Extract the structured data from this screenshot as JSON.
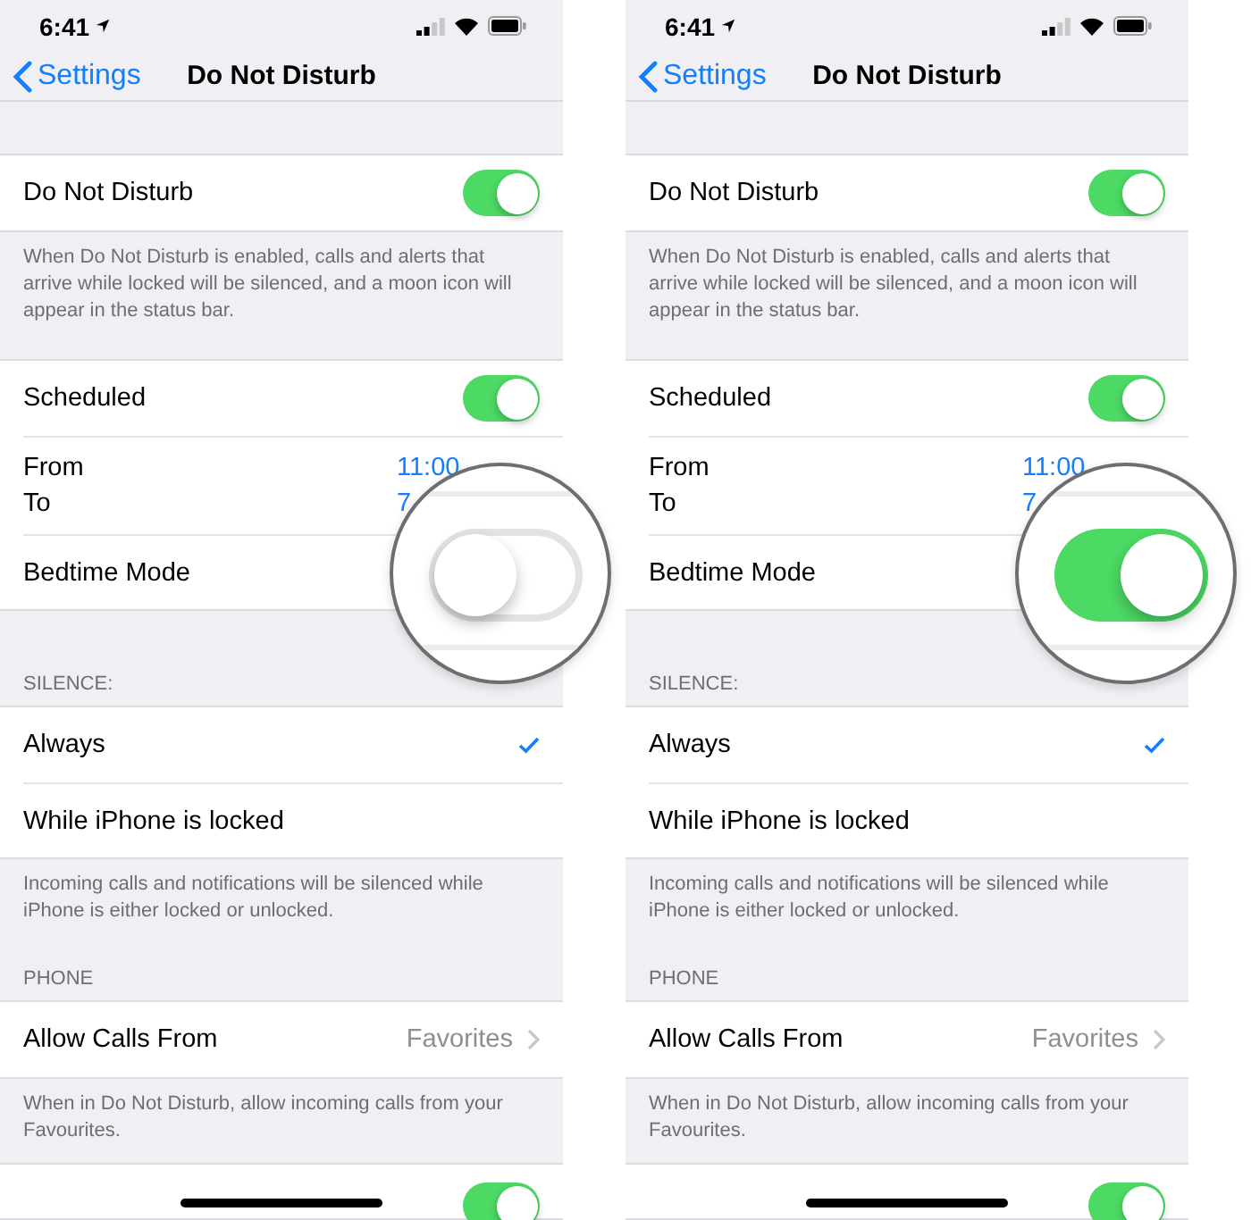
{
  "phones": [
    {
      "status_bar": {
        "time": "6:41"
      },
      "nav": {
        "back": "Settings",
        "title": "Do Not Disturb"
      },
      "groups": [
        {
          "rows": [
            {
              "kind": "toggle",
              "label": "Do Not Disturb",
              "on": true
            }
          ],
          "footer": "When Do Not Disturb is enabled, calls and alerts that arrive while locked will be silenced, and a moon icon will appear in the status bar."
        },
        {
          "rows": [
            {
              "kind": "toggle",
              "label": "Scheduled",
              "on": true
            },
            {
              "kind": "times",
              "from_label": "From",
              "from_value": "11:00",
              "to_label": "To",
              "to_value": "7"
            },
            {
              "kind": "magnified-toggle",
              "label": "Bedtime Mode",
              "on": false
            }
          ]
        },
        {
          "header": "SILENCE:",
          "rows": [
            {
              "kind": "check",
              "label": "Always",
              "selected": true
            },
            {
              "kind": "check",
              "label": "While iPhone is locked",
              "selected": false
            }
          ],
          "footer": "Incoming calls and notifications will be silenced while iPhone is either locked or unlocked."
        },
        {
          "header": "PHONE",
          "rows": [
            {
              "kind": "link",
              "label": "Allow Calls From",
              "value": "Favorites"
            }
          ],
          "footer": "When in Do Not Disturb, allow incoming calls from your Favourites."
        },
        {
          "rows": [
            {
              "kind": "toggle",
              "on": true
            }
          ]
        }
      ]
    },
    {
      "status_bar": {
        "time": "6:41"
      },
      "nav": {
        "back": "Settings",
        "title": "Do Not Disturb"
      },
      "groups": [
        {
          "rows": [
            {
              "kind": "toggle",
              "label": "Do Not Disturb",
              "on": true
            }
          ],
          "footer": "When Do Not Disturb is enabled, calls and alerts that arrive while locked will be silenced, and a moon icon will appear in the status bar."
        },
        {
          "rows": [
            {
              "kind": "toggle",
              "label": "Scheduled",
              "on": true
            },
            {
              "kind": "times",
              "from_label": "From",
              "from_value": "11:00",
              "to_label": "To",
              "to_value": "7"
            },
            {
              "kind": "magnified-toggle",
              "label": "Bedtime Mode",
              "on": true
            }
          ]
        },
        {
          "header": "SILENCE:",
          "rows": [
            {
              "kind": "check",
              "label": "Always",
              "selected": true
            },
            {
              "kind": "check",
              "label": "While iPhone is locked",
              "selected": false
            }
          ],
          "footer": "Incoming calls and notifications will be silenced while iPhone is either locked or unlocked."
        },
        {
          "header": "PHONE",
          "rows": [
            {
              "kind": "link",
              "label": "Allow Calls From",
              "value": "Favorites"
            }
          ],
          "footer": "When in Do Not Disturb, allow incoming calls from your Favourites."
        },
        {
          "rows": [
            {
              "kind": "toggle",
              "on": true
            }
          ]
        }
      ]
    }
  ]
}
